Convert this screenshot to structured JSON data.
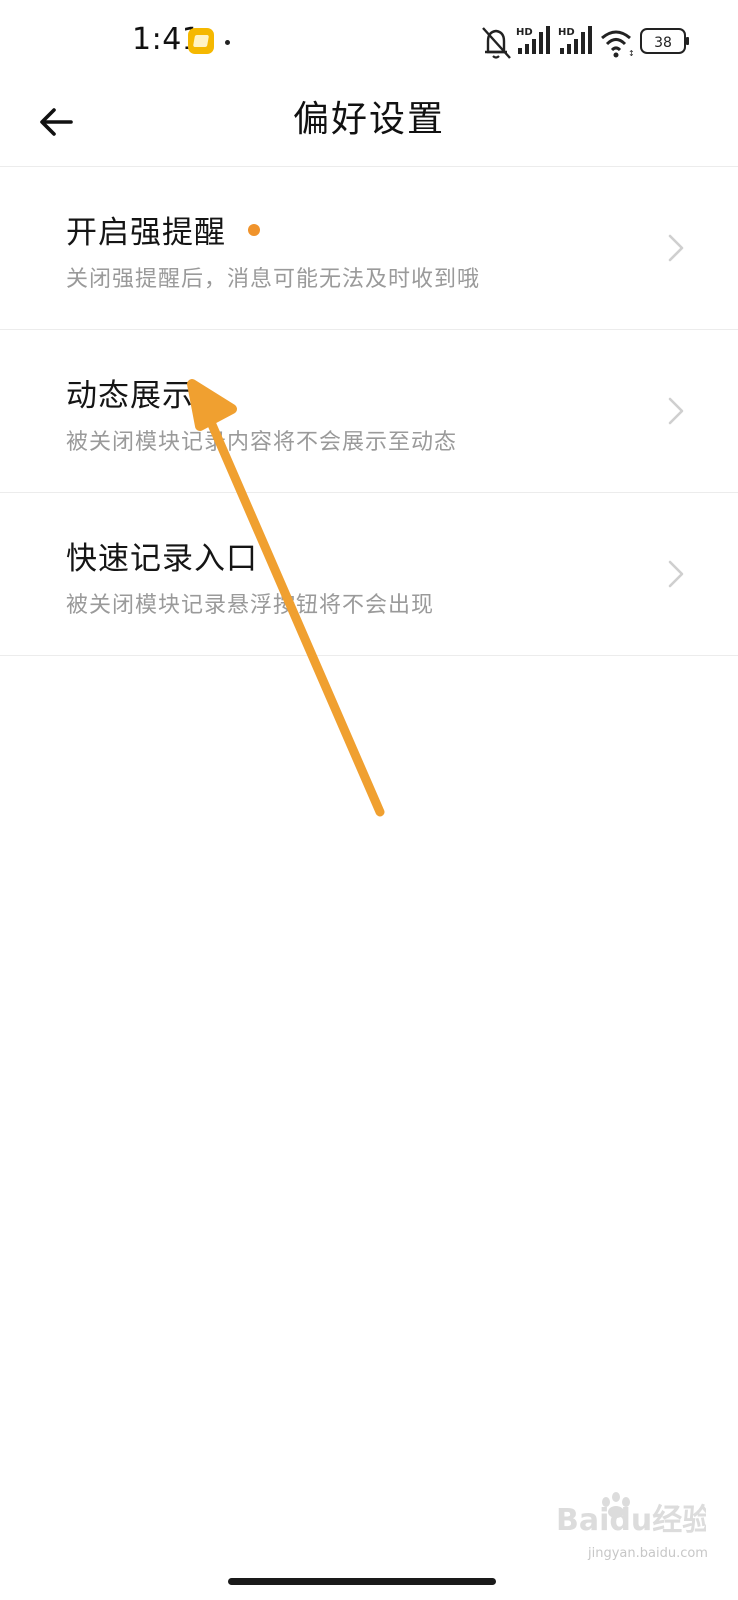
{
  "status_bar": {
    "time": "1:41",
    "battery": "38",
    "signal_label_1": "HD",
    "signal_label_2": "HD"
  },
  "header": {
    "title": "偏好设置"
  },
  "settings": {
    "items": [
      {
        "title": "开启强提醒",
        "subtitle": "关闭强提醒后，消息可能无法及时收到哦",
        "has_dot": true
      },
      {
        "title": "动态展示",
        "subtitle": "被关闭模块记录内容将不会展示至动态"
      },
      {
        "title": "快速记录入口",
        "subtitle": "被关闭模块记录悬浮按钮将不会出现"
      }
    ]
  },
  "colors": {
    "accent_dot": "#f0932b",
    "arrow": "#f0a030",
    "subtitle": "#9a9a9a",
    "divider": "#ececec"
  },
  "watermark": {
    "brand": "Baidu经验",
    "url": "jingyan.baidu.com"
  }
}
